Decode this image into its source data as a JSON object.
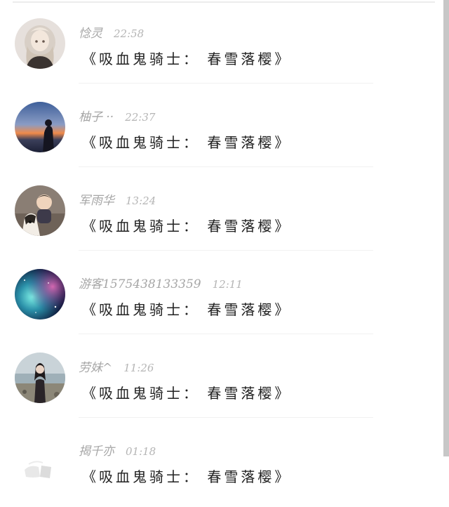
{
  "comments": [
    {
      "username": "惗灵",
      "time": "22:58",
      "message": "《吸血鬼骑士： 春雪落樱》",
      "avatar": "anime-girl-avatar"
    },
    {
      "username": "柚子 ··",
      "time": "22:37",
      "message": "《吸血鬼骑士： 春雪落樱》",
      "avatar": "sunset-silhouette-avatar"
    },
    {
      "username": "军雨华",
      "time": "13:24",
      "message": "《吸血鬼骑士： 春雪落樱》",
      "avatar": "child-with-dog-avatar"
    },
    {
      "username": "游客1575438133359",
      "time": "12:11",
      "message": "《吸血鬼骑士： 春雪落樱》",
      "avatar": "galaxy-nebula-avatar"
    },
    {
      "username": "劳妹^",
      "time": "11:26",
      "message": "《吸血鬼骑士： 春雪落樱》",
      "avatar": "beach-girl-avatar"
    },
    {
      "username": "揭千亦",
      "time": "01:18",
      "message": "《吸血鬼骑士： 春雪落樱》",
      "avatar": "faded-sketch-avatar"
    }
  ]
}
